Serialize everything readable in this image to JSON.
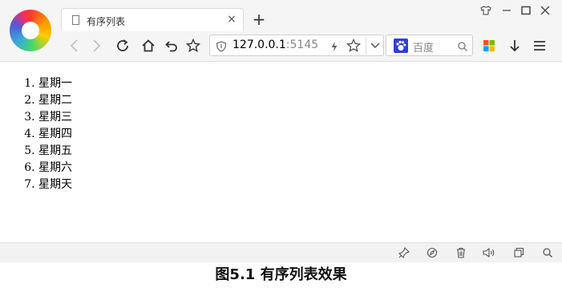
{
  "browser": {
    "tab_title": "有序列表",
    "close_glyph": "×",
    "new_tab_glyph": "+",
    "address": {
      "host": "127.0.0.1",
      "port_fragment": ":5145"
    },
    "search": {
      "engine": "百度"
    },
    "icons": [
      "browser-logo",
      "page-icon",
      "close-icon",
      "plus-icon",
      "shirt-icon",
      "minimize-icon",
      "maximize-icon",
      "window-close-icon",
      "back-arrow-icon",
      "forward-arrow-icon",
      "reload-icon",
      "home-icon",
      "undo-icon",
      "star-icon",
      "shield-icon",
      "lightning-icon",
      "chevron-down-icon",
      "paw-icon",
      "magnifier-icon",
      "apps-grid-icon",
      "download-icon",
      "menu-icon",
      "pin-icon",
      "compass-icon",
      "trash-icon",
      "speaker-icon",
      "window-restore-icon",
      "zoom-icon"
    ]
  },
  "page": {
    "list_items": [
      "星期一",
      "星期二",
      "星期三",
      "星期四",
      "星期五",
      "星期六",
      "星期天"
    ]
  },
  "caption": "图5.1  有序列表效果"
}
